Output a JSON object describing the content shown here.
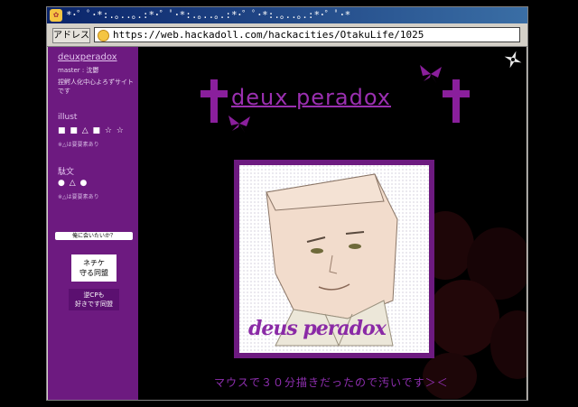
{
  "window": {
    "title": "*･゜ﾟ･*:.｡..｡.:*･゜ﾟ･*:.｡..｡.:*･゜ﾟ･*:.｡..｡.:*･゜ﾟ･*",
    "address_label": "アドレス",
    "url": "https://web.hackadoll.com/hackacities/OtakuLife/1025"
  },
  "sidebar": {
    "site_name": "deuxperadox",
    "master_line": "master : 沈鬱",
    "description": "捏鰐人化中心よろずサイトです",
    "illust_heading": "illust",
    "illust_icons": "■ ■ △ ■ ☆ ☆",
    "illust_note": "※△は要要素あり",
    "text_heading": "駄文",
    "text_icons": "● △ ●",
    "text_note": "※△は要要素あり",
    "meet_button": "俺に会いたいか？",
    "banner1_line1": "ネチケ",
    "banner1_line2": "守る同盟",
    "banner2_line1": "逆CPも",
    "banner2_line2": "好きです同盟"
  },
  "main": {
    "site_title": "deux peradox",
    "art_signature": "deus peradox",
    "caption": "マウスで３０分描きだったので汚いです＞＜"
  },
  "colors": {
    "accent": "#9a2fb0",
    "sidebar": "#6d1a80",
    "background": "#000000"
  }
}
